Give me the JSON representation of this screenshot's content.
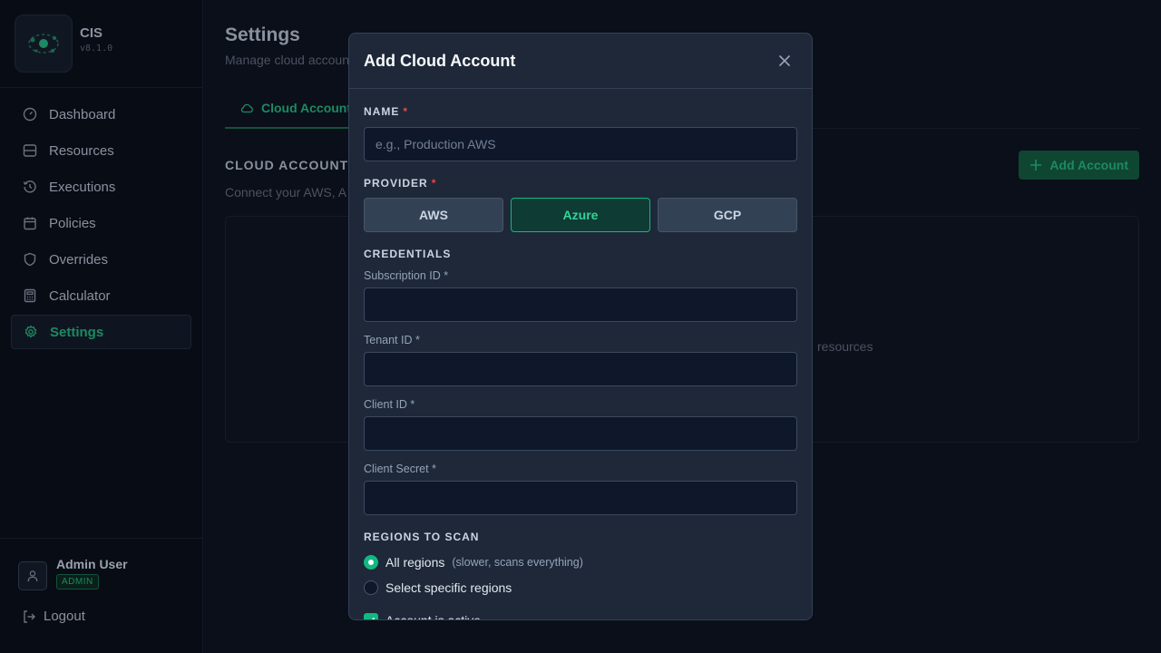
{
  "sidebar": {
    "app_name": "CIS",
    "version": "v8.1.0",
    "nav_items": [
      {
        "label": "Dashboard",
        "icon": "gauge-icon"
      },
      {
        "label": "Resources",
        "icon": "server-icon"
      },
      {
        "label": "Executions",
        "icon": "history-icon"
      },
      {
        "label": "Policies",
        "icon": "calendar-icon"
      },
      {
        "label": "Overrides",
        "icon": "shield-icon"
      },
      {
        "label": "Calculator",
        "icon": "calculator-icon"
      },
      {
        "label": "Settings",
        "icon": "gear-icon",
        "active": true
      }
    ],
    "user": {
      "name": "Admin User",
      "role": "ADMIN"
    },
    "logout_label": "Logout"
  },
  "main": {
    "title": "Settings",
    "subtitle": "Manage cloud accoun",
    "tab_label": "Cloud Account",
    "section_title": "CLOUD ACCOUNTS",
    "section_desc": "Connect your AWS, A",
    "add_account_label": "Add Account",
    "empty_text_fragment": "resources"
  },
  "modal": {
    "title": "Add Cloud Account",
    "name_label": "NAME",
    "name_placeholder": "e.g., Production AWS",
    "name_value": "",
    "provider_label": "PROVIDER",
    "providers": [
      "AWS",
      "Azure",
      "GCP"
    ],
    "selected_provider": "Azure",
    "credentials_label": "CREDENTIALS",
    "fields": [
      {
        "label": "Subscription ID *",
        "value": ""
      },
      {
        "label": "Tenant ID *",
        "value": ""
      },
      {
        "label": "Client ID *",
        "value": ""
      },
      {
        "label": "Client Secret *",
        "value": ""
      }
    ],
    "regions_label": "REGIONS TO SCAN",
    "region_all_label": "All regions",
    "region_all_hint": "(slower, scans everything)",
    "region_specific_label": "Select specific regions",
    "active_label": "Account is active"
  },
  "colors": {
    "accent": "#10b981",
    "accent_text": "#34d399",
    "required": "#ef4444",
    "modal_bg": "#1e2838"
  }
}
